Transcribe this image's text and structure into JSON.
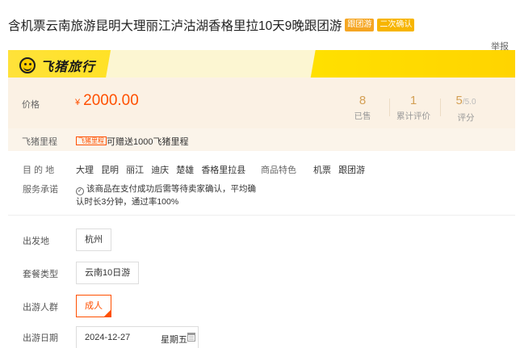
{
  "header": {
    "title": "含机票云南旅游昆明大理丽江泸沽湖香格里拉10天9晚跟团游",
    "tags": [
      "跟团游",
      "二次确认"
    ],
    "report_label": "举报"
  },
  "brand": {
    "name": "飞猪旅行",
    "accent": "#ffe000"
  },
  "price_panel": {
    "label": "价格",
    "currency": "¥",
    "price": "2000.00",
    "stats": [
      {
        "value": "8",
        "suffix": "",
        "label": "已售"
      },
      {
        "value": "1",
        "suffix": "",
        "label": "累计评价"
      },
      {
        "value": "5",
        "suffix": "/5.0",
        "label": "评分"
      }
    ],
    "price_color": "#ff5000"
  },
  "miles": {
    "label": "飞猪里程",
    "badge": "飞猪里程",
    "text": "可赠送1000飞猪里程"
  },
  "destination": {
    "label": "目 的 地",
    "places": [
      "大理",
      "昆明",
      "丽江",
      "迪庆",
      "楚雄",
      "香格里拉县"
    ],
    "feature_label": "商品特色",
    "features": [
      "机票",
      "跟团游"
    ]
  },
  "service": {
    "label": "服务承诺",
    "text": "该商品在支付成功后需等待卖家确认，平均确认时长3分钟，通过率100%"
  },
  "options": {
    "departure": {
      "label": "出发地",
      "value": "杭州"
    },
    "package": {
      "label": "套餐类型",
      "value": "云南10日游"
    },
    "traveler": {
      "label": "出游人群",
      "value": "成人"
    },
    "date": {
      "label": "出游日期",
      "value": "2024-12-27",
      "weekday": "星期五"
    }
  }
}
